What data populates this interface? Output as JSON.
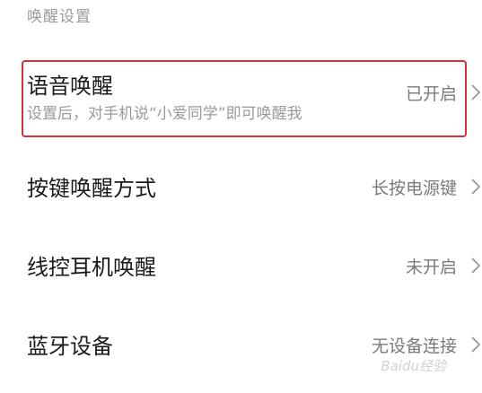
{
  "section": {
    "title": "唤醒设置"
  },
  "rows": [
    {
      "id": "voice",
      "title": "语音唤醒",
      "subtitle": "设置后，对手机说“小爱同学”即可唤醒我",
      "value": "已开启",
      "icon": "chevron-right-icon"
    },
    {
      "id": "key",
      "title": "按键唤醒方式",
      "value": "长按电源键",
      "icon": "chevron-right-icon"
    },
    {
      "id": "wired",
      "title": "线控耳机唤醒",
      "value": "未开启",
      "icon": "chevron-right-icon"
    },
    {
      "id": "bluetooth",
      "title": "蓝牙设备",
      "value": "无设备连接",
      "icon": "chevron-right-icon"
    }
  ],
  "watermark": "Baidu经验",
  "colors": {
    "highlight": "#d6303a",
    "title": "#1a1a1a",
    "secondary": "#9a9a9a"
  }
}
